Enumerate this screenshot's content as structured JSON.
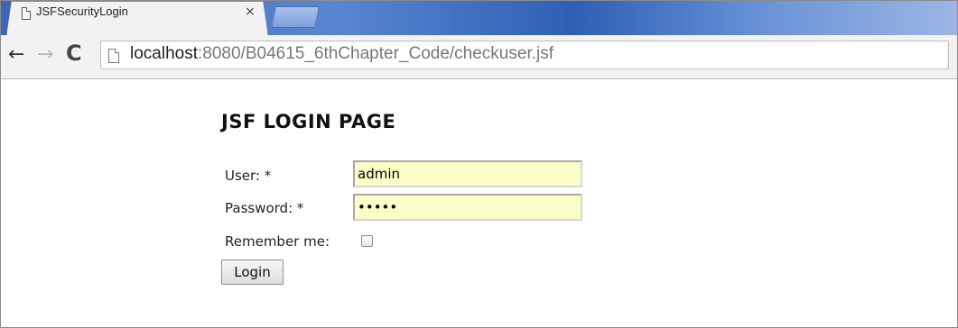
{
  "browser": {
    "tab_title": "JSFSecurityLogin",
    "tab_close": "×",
    "back_glyph": "←",
    "forward_glyph": "→",
    "reload_glyph": "C",
    "url_host": "localhost",
    "url_rest": ":8080/B04615_6thChapter_Code/checkuser.jsf"
  },
  "page": {
    "heading": "JSF LOGIN PAGE",
    "user_label": "User: *",
    "user_value": "admin",
    "password_label": "Password: *",
    "password_value": "admin",
    "remember_label": "Remember me:",
    "remember_checked": false,
    "login_button": "Login"
  },
  "colors": {
    "field_background": "#fbffc6",
    "tabstrip_blue": "#3d66b8"
  },
  "icons": {
    "tab_icon": "page-icon",
    "omnibox_icon": "page-icon"
  }
}
